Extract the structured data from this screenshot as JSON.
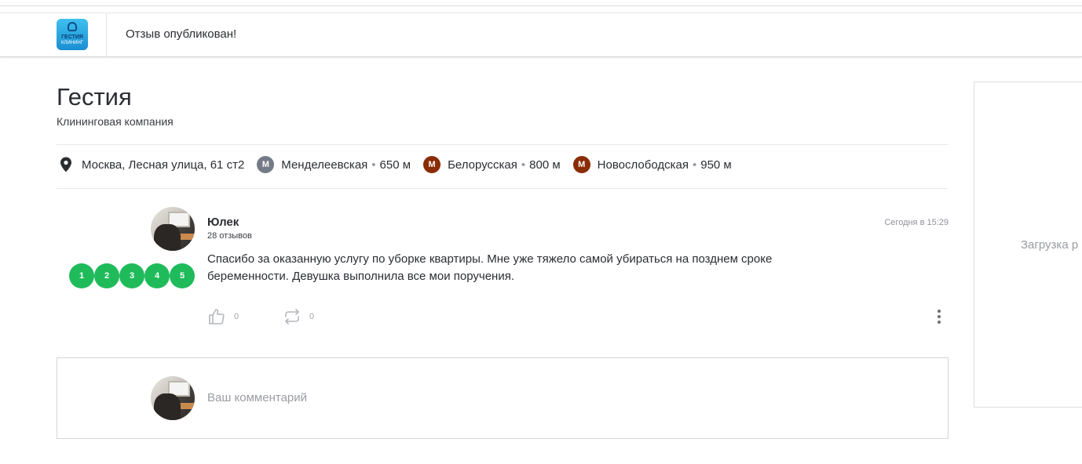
{
  "header": {
    "logo": {
      "line1": "ГЕСТИЯ",
      "line2": "КЛИНИНГ"
    },
    "message": "Отзыв опубликован!"
  },
  "company": {
    "name": "Гестия",
    "type": "Клининговая компания",
    "address": "Москва, Лесная улица, 61 ст2",
    "metro": [
      {
        "name": "Менделеевская",
        "distance": "650 м",
        "color": "#747a86",
        "icon": "metro-icon"
      },
      {
        "name": "Белорусская",
        "distance": "800 м",
        "color": "#8a2c04",
        "icon": "metro-icon"
      },
      {
        "name": "Новослободская",
        "distance": "950 м",
        "color": "#8a2c04",
        "icon": "metro-icon"
      }
    ]
  },
  "review": {
    "author": "Юлек",
    "reviews_count": "28 отзывов",
    "date": "Сегодня в 15:29",
    "text": "Спасибо за оказанную услугу по уборке квартиры. Мне уже тяжело самой убираться на позднем сроке беременности. Девушка выполнила все мои поручения.",
    "ratings": [
      "1",
      "2",
      "3",
      "4",
      "5"
    ],
    "rating_color": "#1fbb5b",
    "likes": "0",
    "reposts": "0"
  },
  "comment": {
    "placeholder": "Ваш комментарий"
  },
  "side_panel": {
    "loading": "Загрузка р"
  }
}
